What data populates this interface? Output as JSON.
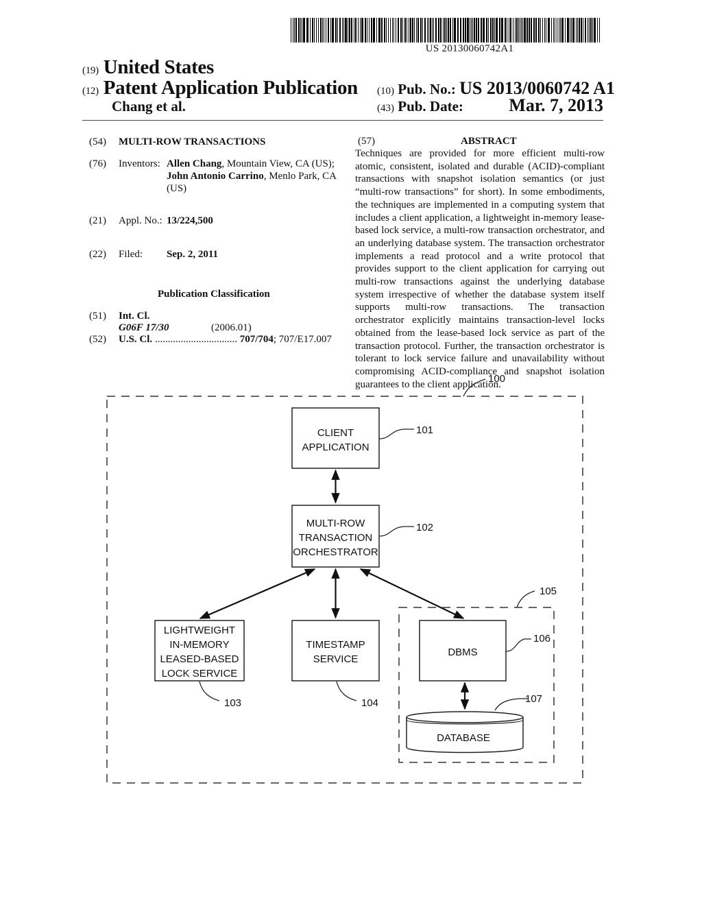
{
  "header": {
    "barcode_number": "US 20130060742A1",
    "country_code": "(19)",
    "country": "United States",
    "pubtype_code": "(12)",
    "pubtype": "Patent Application Publication",
    "authors": "Chang et al.",
    "pubno_code": "(10)",
    "pubno_label": "Pub. No.:",
    "pubno": "US 2013/0060742 A1",
    "pubdate_code": "(43)",
    "pubdate_label": "Pub. Date:",
    "pubdate": "Mar. 7, 2013"
  },
  "biblio": {
    "title": {
      "code": "(54)",
      "value": "MULTI-ROW TRANSACTIONS"
    },
    "inventors": {
      "code": "(76)",
      "label": "Inventors:",
      "list": [
        {
          "name": "Allen Chang",
          "location": ", Mountain View, CA (US);"
        },
        {
          "name": "John Antonio Carrino",
          "location": ", Menlo Park, CA (US)"
        }
      ]
    },
    "appl_no": {
      "code": "(21)",
      "label": "Appl. No.:",
      "value": "13/224,500"
    },
    "filed": {
      "code": "(22)",
      "label": "Filed:",
      "value": "Sep. 2, 2011"
    },
    "pub_class_heading": "Publication Classification",
    "int_cl": {
      "code": "(51)",
      "label": "Int. Cl.",
      "class": "G06F 17/30",
      "version": "(2006.01)"
    },
    "us_cl": {
      "code": "(52)",
      "label": "U.S. Cl.",
      "dots": "................................",
      "primary": "707/704",
      "secondary": "; 707/E17.007"
    }
  },
  "abstract": {
    "code": "(57)",
    "heading": "ABSTRACT",
    "text": "Techniques are provided for more efficient multi-row atomic, consistent, isolated and durable (ACID)-compliant transac­tions with snapshot isolation semantics (or just “multi-row transactions” for short). In some embodiments, the tech­niques are implemented in a computing system that includes a client application, a lightweight in-memory lease-based lock service, a multi-row transaction orchestrator, and an underlying database system. The transaction orchestrator implements a read protocol and a write protocol that provides support to the client application for carrying out multi-row transactions against the underlying database system irrespec­tive of whether the database system itself supports multi-row transactions. The transaction orchestrator explicitly main­tains transaction-level locks obtained from the lease-based lock service as part of the transaction protocol. Further, the transaction orchestrator is tolerant to lock service failure and unavailability without compromising ACID-compliance and snapshot isolation guarantees to the client application."
  },
  "figure": {
    "system_ref": "100",
    "storage_ref": "105",
    "nodes": {
      "client": {
        "ref": "101",
        "lines": [
          "CLIENT",
          "APPLICATION"
        ]
      },
      "orchestrator": {
        "ref": "102",
        "lines": [
          "MULTI-ROW",
          "TRANSACTION",
          "ORCHESTRATOR"
        ]
      },
      "lock": {
        "ref": "103",
        "lines": [
          "LIGHTWEIGHT",
          "IN-MEMORY",
          "LEASED-BASED",
          "LOCK SERVICE"
        ]
      },
      "timestamp": {
        "ref": "104",
        "lines": [
          "TIMESTAMP",
          "SERVICE"
        ]
      },
      "dbms": {
        "ref": "106",
        "lines": [
          "DBMS"
        ]
      },
      "database": {
        "ref": "107",
        "lines": [
          "DATABASE"
        ]
      }
    }
  }
}
